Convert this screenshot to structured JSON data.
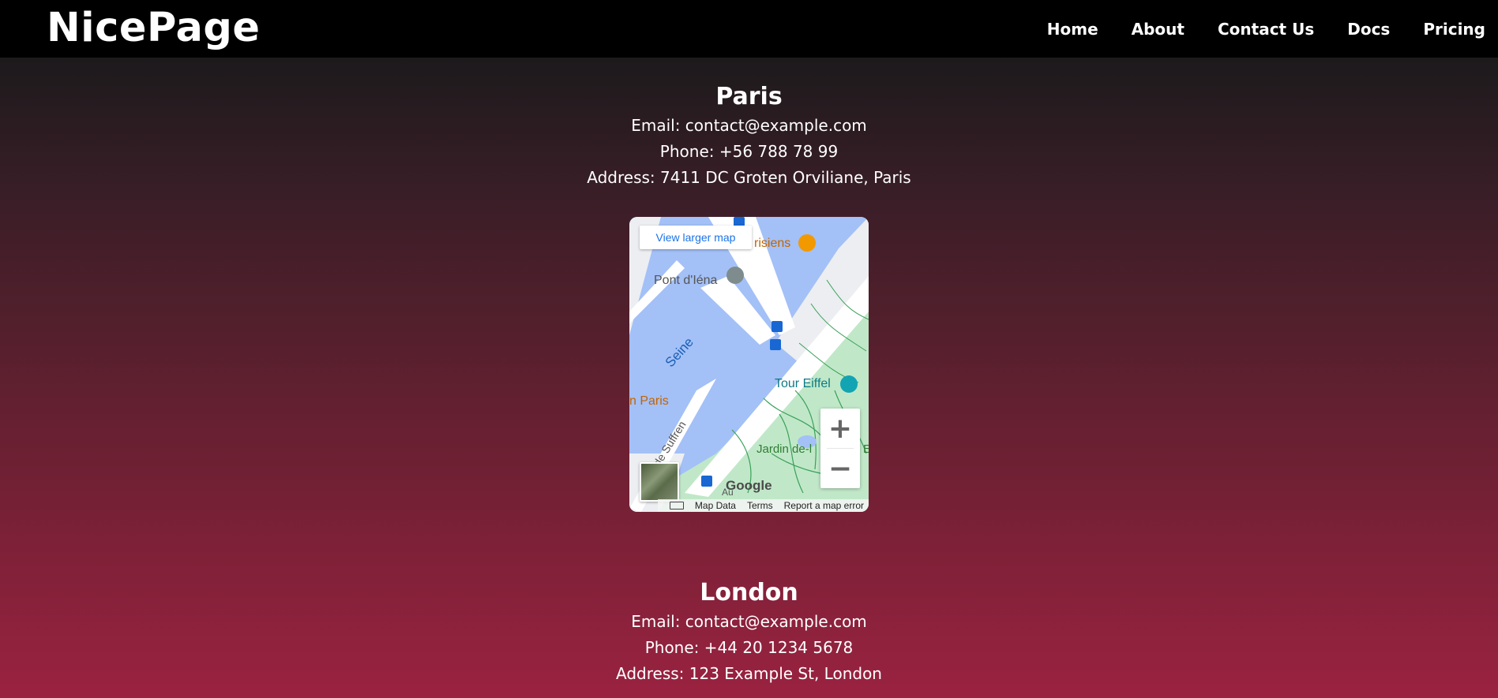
{
  "brand": "NicePage",
  "nav": [
    "Home",
    "About",
    "Contact Us",
    "Docs",
    "Pricing"
  ],
  "offices": [
    {
      "city": "Paris",
      "email": "Email: contact@example.com",
      "phone": "Phone: +56 788 78 99",
      "address": "Address: 7411 DC Groten Orviliane, Paris"
    },
    {
      "city": "London",
      "email": "Email: contact@example.com",
      "phone": "Phone: +44 20 1234 5678",
      "address": "Address: 123 Example St, London"
    }
  ],
  "map": {
    "view_larger": "View larger map",
    "zoom_in": "+",
    "zoom_out": "−",
    "labels": {
      "pont": "Pont d'Iéna",
      "seine": "Seine",
      "tour": "Tour Eiffel",
      "jardin": "Jardin de-l",
      "paris": "n Paris",
      "suffren": "Port de Suffren",
      "resto": "risiens",
      "e_edge": "E",
      "au": "Au",
      "google": "Google"
    },
    "footer": {
      "map_data": "Map Data",
      "terms": "Terms",
      "report": "Report a map error"
    },
    "icons": [
      "bus-stop-icon",
      "restaurant-icon",
      "bridge-icon",
      "monument-icon",
      "keyboard-icon"
    ]
  },
  "colors": {
    "nav_bg": "#000000",
    "water": "#a3c0f7",
    "park": "#c0e8c8",
    "link": "#1a73e8"
  }
}
